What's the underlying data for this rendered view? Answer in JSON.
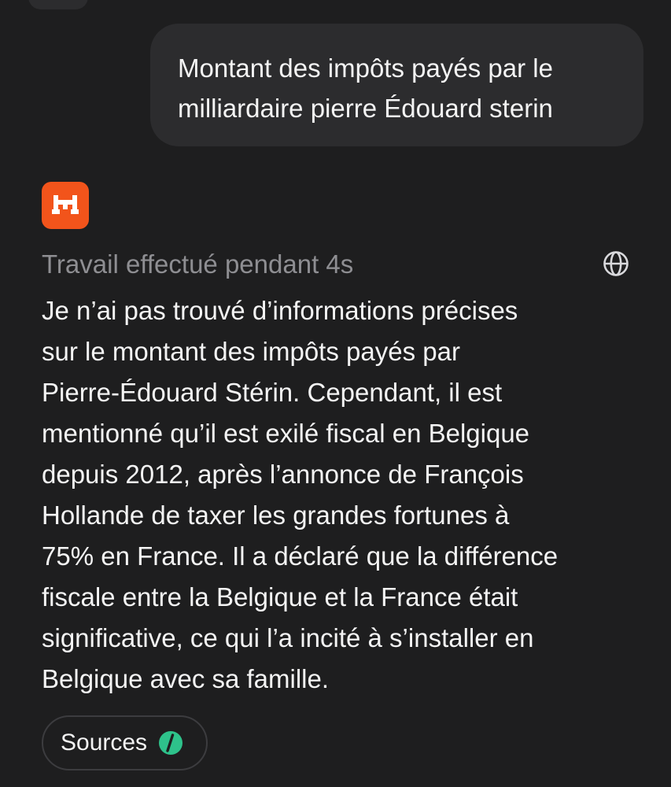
{
  "user_message": {
    "lines": [
      "Montant des impôts payés par le",
      "milliardaire pierre Édouard sterin"
    ]
  },
  "assistant": {
    "logo_icon": "mistral-logo-icon",
    "status": "Travail effectué pendant 4s",
    "web_icon": "globe-icon",
    "answer_lines": [
      "Je n’ai pas trouvé d’informations précises",
      "sur le montant des impôts payés par",
      "Pierre-Édouard Stérin. Cependant, il est",
      "mentionné qu’il est exilé fiscal en Belgique",
      "depuis 2012, après l’annonce de François",
      "Hollande de taxer les grandes fortunes à",
      "75% en France. Il a déclaré que la différence",
      "fiscale entre la Belgique et la France était",
      "significative, ce qui l’a incité à s’installer en",
      "Belgique avec sa famille."
    ],
    "sources_label": "Sources",
    "sources_icon": "source-favicon-icon"
  },
  "colors": {
    "background": "#1e1e1f",
    "bubble": "#2c2c2e",
    "brand": "#f2541b",
    "muted_text": "#8e8e92",
    "source_favicon": "#2ec28b"
  }
}
